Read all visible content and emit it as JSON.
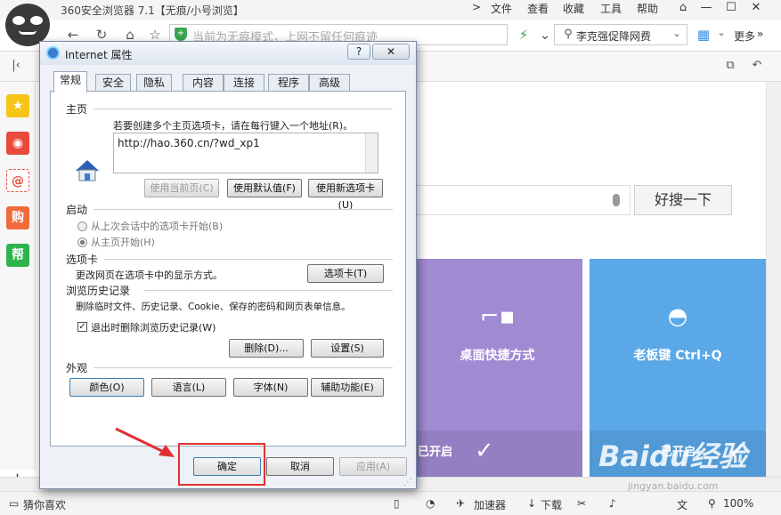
{
  "browser": {
    "title": "360安全浏览器 7.1【无痕/小号浏览】",
    "menu": [
      "文件",
      "查看",
      "收藏",
      "工具",
      "帮助"
    ],
    "address_text": "当前为无痕模式，上网不留任何痕迹",
    "search_text": "李克强促降网费",
    "more_label": "更多",
    "search_button": "好搜一下",
    "card1_label": "桌面快捷方式",
    "card1_status": "已开启",
    "card2_label": "老板键 Ctrl+Q",
    "card2_status": "已开启",
    "status_left": "猜你喜欢",
    "status_accel": "加速器",
    "status_download": "下载",
    "zoom": "100%",
    "watermark": "Baidu经验",
    "watermark_url": "jingyan.baidu.com",
    "sidebar_icons": [
      "star-icon",
      "weibo-icon",
      "mail-icon",
      "shop-icon",
      "help-icon"
    ],
    "sidebar_help": "帮",
    "sidebar_shop": "购"
  },
  "dialog": {
    "title": "Internet 属性",
    "help_btn": "?",
    "close_btn": "✕",
    "tabs": [
      "常规",
      "安全",
      "隐私",
      "内容",
      "连接",
      "程序",
      "高级"
    ],
    "home_section": "主页",
    "home_desc": "若要创建多个主页选项卡，请在每行键入一个地址(R)。",
    "home_url": "http://hao.360.cn/?wd_xp1",
    "btn_use_current": "使用当前页(C)",
    "btn_use_default": "使用默认值(F)",
    "btn_use_newtab": "使用新选项卡(U)",
    "startup_section": "启动",
    "startup_opt1": "从上次会话中的选项卡开始(B)",
    "startup_opt2": "从主页开始(H)",
    "tabs_section": "选项卡",
    "tabs_desc": "更改网页在选项卡中的显示方式。",
    "btn_tabs": "选项卡(T)",
    "history_section": "浏览历史记录",
    "history_desc": "删除临时文件、历史记录、Cookie、保存的密码和网页表单信息。",
    "history_check": "退出时删除浏览历史记录(W)",
    "btn_delete": "删除(D)...",
    "btn_settings": "设置(S)",
    "appearance_section": "外观",
    "btn_colors": "颜色(O)",
    "btn_languages": "语言(L)",
    "btn_fonts": "字体(N)",
    "btn_accessibility": "辅助功能(E)",
    "btn_ok": "确定",
    "btn_cancel": "取消",
    "btn_apply": "应用(A)"
  },
  "colors": {
    "card1": "#a08ad2",
    "card2": "#5aa8e8",
    "highlight": "#e03030"
  }
}
